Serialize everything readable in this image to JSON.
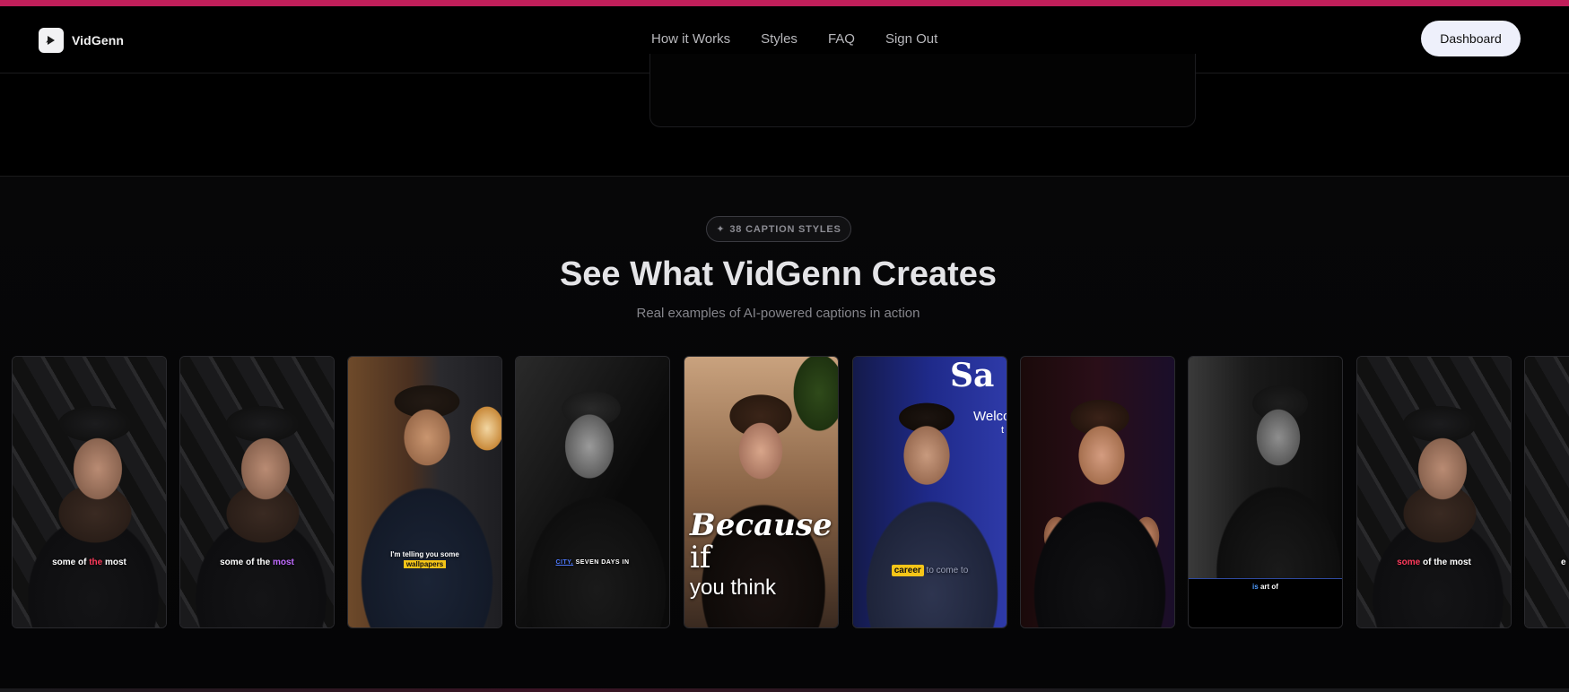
{
  "nav": {
    "brand": "VidGenn",
    "links": [
      "How it Works",
      "Styles",
      "FAQ",
      "Sign Out"
    ],
    "dashboard_label": "Dashboard"
  },
  "styles_section": {
    "badge": "38 CAPTION STYLES",
    "heading": "See What VidGenn Creates",
    "subheading": "Real examples of AI-powered captions in action"
  },
  "captions": {
    "c1": [
      "some of ",
      "the",
      " most"
    ],
    "c2": [
      "some of the ",
      "most"
    ],
    "c3": [
      "I'm telling you some",
      "wallpapers"
    ],
    "c4": [
      "CITY,",
      " SEVEN DAYS IN"
    ],
    "c5": [
      "Because",
      " if",
      "you think"
    ],
    "c6": [
      "career",
      " to come to"
    ],
    "c6_sign": [
      "Sa",
      "Welco",
      "t"
    ],
    "c8": [
      "is",
      " art of"
    ],
    "c9": [
      "some",
      " of the most"
    ],
    "c10": [
      "e"
    ]
  },
  "colors": {
    "accent": "#c01f5a",
    "highlight_red": "#ff3b5c",
    "highlight_purple": "#c06bff",
    "highlight_yellow": "#f5c518",
    "highlight_blue": "#4f7bff"
  },
  "icons": [
    "play-logo-icon",
    "sparkle-icon"
  ]
}
